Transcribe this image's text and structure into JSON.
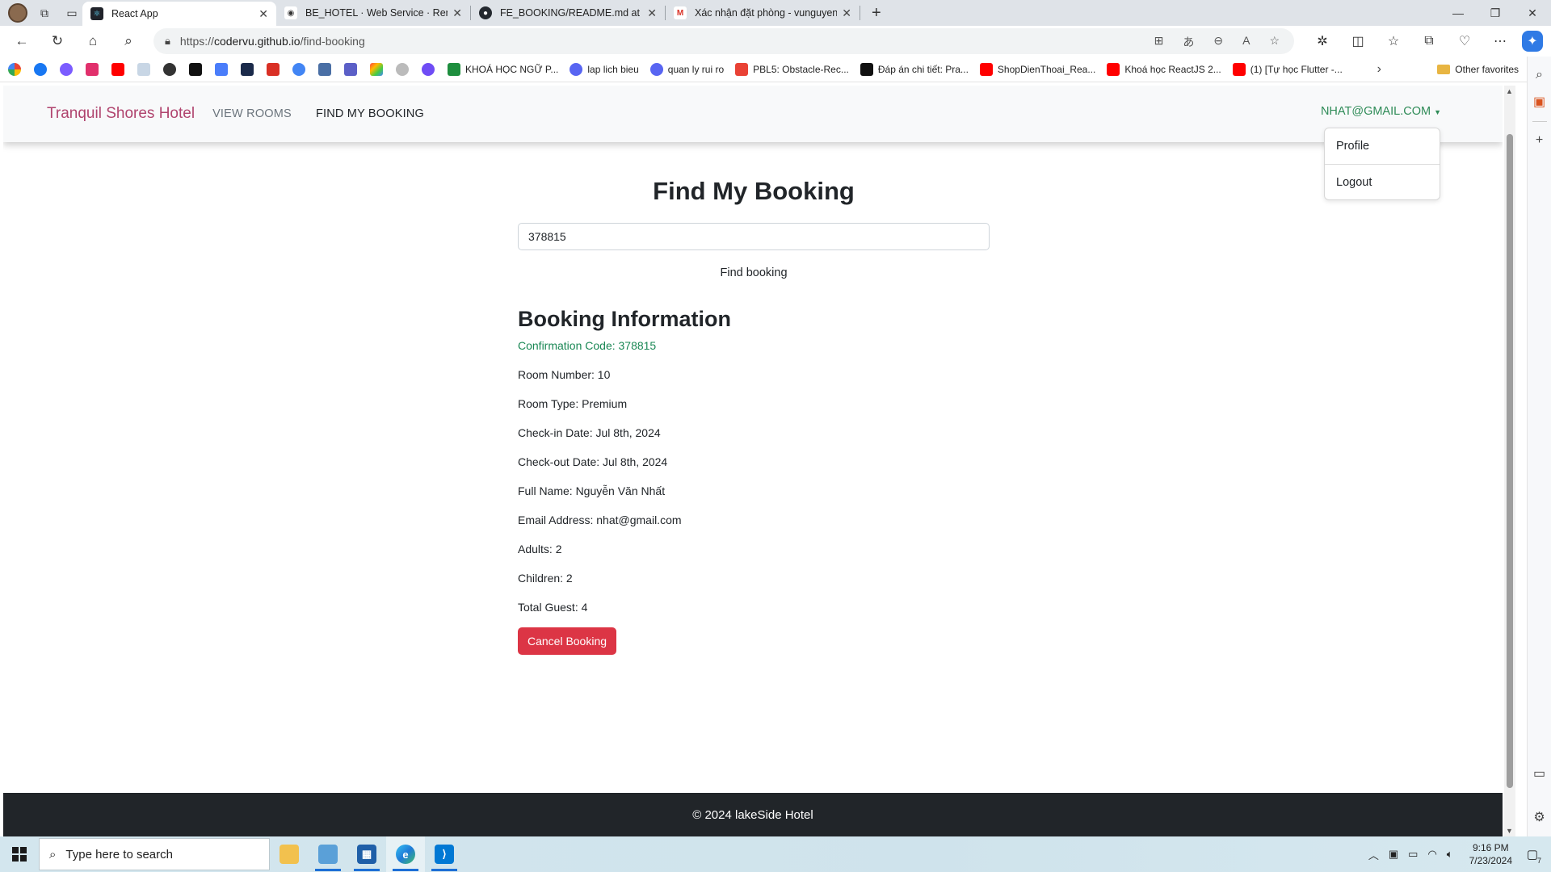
{
  "browser": {
    "tabs": [
      {
        "title": "React App",
        "active": true
      },
      {
        "title": "BE_HOTEL · Web Service · Rende",
        "active": false
      },
      {
        "title": "FE_BOOKING/README.md at de",
        "active": false
      },
      {
        "title": "Xác nhận đặt phòng - vunguyen",
        "active": false
      }
    ],
    "url_prefix": "https://",
    "url_host": "codervu.github.io",
    "url_path": "/find-booking",
    "bookmarks": [
      "KHOÁ HỌC NGỮ P...",
      "lap lich bieu",
      "quan ly rui ro",
      "PBL5: Obstacle-Rec...",
      "Đáp án chi tiết: Pra...",
      "ShopDienThoai_Rea...",
      "Khoá học ReactJS 2...",
      "(1) [Tự học Flutter -..."
    ],
    "other_favorites": "Other favorites"
  },
  "app": {
    "brand": "Tranquil Shores Hotel",
    "nav": {
      "view_rooms": "VIEW ROOMS",
      "find_booking": "FIND MY BOOKING",
      "user": "NHAT@GMAIL.COM"
    },
    "dropdown": {
      "profile": "Profile",
      "logout": "Logout"
    },
    "page_title": "Find My Booking",
    "search": {
      "value": "378815"
    },
    "find_button": "Find booking",
    "booking": {
      "heading": "Booking Information",
      "confirmation": "Confirmation Code: 378815",
      "room_number": "Room Number: 10",
      "room_type": "Room Type: Premium",
      "check_in": "Check-in Date: Jul 8th, 2024",
      "check_out": "Check-out Date: Jul 8th, 2024",
      "full_name": "Full Name: Nguyễn Văn Nhất",
      "email": "Email Address: nhat@gmail.com",
      "adults": "Adults: 2",
      "children": "Children: 2",
      "total_guest": "Total Guest: 4"
    },
    "cancel_button": "Cancel Booking",
    "footer": "© 2024 lakeSide Hotel"
  },
  "taskbar": {
    "search_placeholder": "Type here to search",
    "time": "9:16 PM",
    "date": "7/23/2024",
    "notification_count": "7"
  },
  "colors": {
    "brand": "#b0446e",
    "user_link": "#2e8b57",
    "confirmation": "#198754",
    "cancel": "#dc3545",
    "footer_bg": "#212529"
  }
}
